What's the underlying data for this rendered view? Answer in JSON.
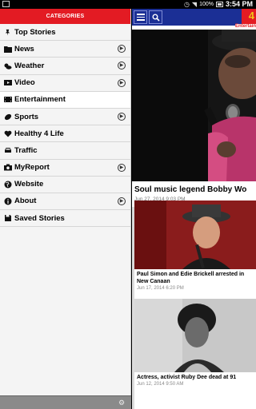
{
  "status_bar": {
    "battery": "100%",
    "time": "3:54 PM"
  },
  "drawer": {
    "header": "CATEGORIES",
    "items": [
      {
        "label": "Top Stories",
        "icon": "pin-icon",
        "chevron": false,
        "active": false
      },
      {
        "label": "News",
        "icon": "folder-icon",
        "chevron": true,
        "active": false
      },
      {
        "label": "Weather",
        "icon": "weather-icon",
        "chevron": true,
        "active": false
      },
      {
        "label": "Video",
        "icon": "video-icon",
        "chevron": true,
        "active": false
      },
      {
        "label": "Entertainment",
        "icon": "film-icon",
        "chevron": false,
        "active": true
      },
      {
        "label": "Sports",
        "icon": "football-icon",
        "chevron": true,
        "active": false
      },
      {
        "label": "Healthy 4 Life",
        "icon": "heart-icon",
        "chevron": false,
        "active": false
      },
      {
        "label": "Traffic",
        "icon": "car-icon",
        "chevron": false,
        "active": false
      },
      {
        "label": "MyReport",
        "icon": "camera-icon",
        "chevron": true,
        "active": false
      },
      {
        "label": "Website",
        "icon": "globe-icon",
        "chevron": false,
        "active": false
      },
      {
        "label": "About",
        "icon": "info-icon",
        "chevron": true,
        "active": false
      },
      {
        "label": "Saved Stories",
        "icon": "save-icon",
        "chevron": false,
        "active": false
      }
    ]
  },
  "content": {
    "logo_text": "4",
    "section_label": "Entertain",
    "hero": {
      "title": "Soul music legend Bobby Wo",
      "date": "Jun 27, 2014 9:03 PM"
    },
    "cards": [
      {
        "title": "Paul Simon and Edie Brickell arrested in New Canaan",
        "date": "Jun 17, 2014 6:20 PM"
      },
      {
        "title": "Actress, activist Ruby Dee dead at 91",
        "date": "Jun 12, 2014 9:50 AM"
      }
    ]
  },
  "colors": {
    "drawer_header": "#e31b23",
    "app_bar": "#1b2f95"
  }
}
